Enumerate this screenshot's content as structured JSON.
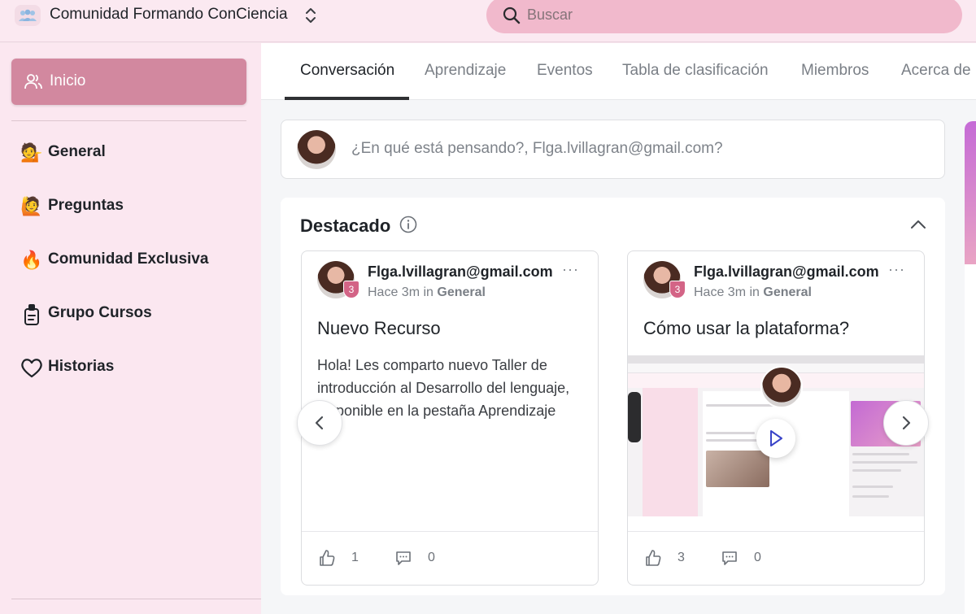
{
  "header": {
    "community_name": "Comunidad Formando ConCiencia",
    "search_placeholder": "Buscar"
  },
  "sidebar": {
    "active_item": {
      "label": "Inicio",
      "icon": "users-icon"
    },
    "items": [
      {
        "label": "General",
        "icon": "person-tipping-hand-icon",
        "emoji": "💁"
      },
      {
        "label": "Preguntas",
        "icon": "person-raising-hand-icon",
        "emoji": "🙋"
      },
      {
        "label": "Comunidad Exclusiva",
        "icon": "fire-lock-icon",
        "emoji": "🔥"
      },
      {
        "label": "Grupo Cursos",
        "icon": "clipboard-lock-icon",
        "emoji": ""
      },
      {
        "label": "Historias",
        "icon": "heart-icon",
        "emoji": ""
      }
    ]
  },
  "tabs": [
    {
      "label": "Conversación",
      "active": true
    },
    {
      "label": "Aprendizaje",
      "active": false
    },
    {
      "label": "Eventos",
      "active": false
    },
    {
      "label": "Tabla de clasificación",
      "active": false
    },
    {
      "label": "Miembros",
      "active": false
    },
    {
      "label": "Acerca de",
      "active": false
    }
  ],
  "composer": {
    "prompt": "¿En qué está pensando?, Flga.lvillagran@gmail.com?"
  },
  "featured": {
    "title": "Destacado",
    "posts": [
      {
        "author": "Flga.lvillagran@gmail.com V",
        "level": "3",
        "time": "Hace 3m",
        "in_word": "in",
        "space": "General",
        "title": "Nuevo Recurso",
        "body": "Hola! Les comparto nuevo Taller de introducción al Desarrollo del lenguaje, disponible en la pestaña Aprendizaje",
        "likes": "1",
        "comments": "0"
      },
      {
        "author": "Flga.lvillagran@gmail.com V",
        "level": "3",
        "time": "Hace 3m",
        "in_word": "in",
        "space": "General",
        "title": "Cómo usar la plataforma?",
        "likes": "3",
        "comments": "0"
      }
    ]
  },
  "colors": {
    "accent": "#d2889f",
    "search_bg": "#f1b9cc",
    "sidebar_bg": "#fbe7f0",
    "badge": "#d36486"
  }
}
